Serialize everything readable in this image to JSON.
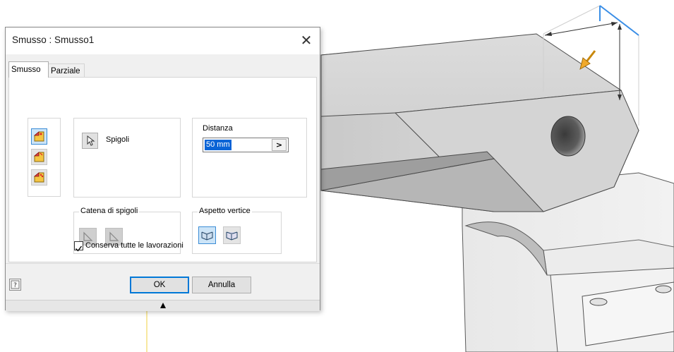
{
  "dialog": {
    "title": "Smusso : Smusso1",
    "close_glyph": "✕"
  },
  "tabs": [
    {
      "label": "Smusso",
      "active": true
    },
    {
      "label": "Parziale",
      "active": false
    }
  ],
  "modes": [
    "chamfer-distance-icon",
    "chamfer-distance-angle-icon",
    "chamfer-two-distances-icon"
  ],
  "edges": {
    "label": "Spigoli",
    "icon": "cursor-select-icon"
  },
  "distance": {
    "label": "Distanza",
    "value": "50 mm",
    "arrow": ">"
  },
  "edge_chain": {
    "label": "Catena di spigoli",
    "buttons": [
      "single-edge-icon",
      "all-tangent-edges-icon"
    ]
  },
  "vertex_setback": {
    "label": "Aspetto vertice",
    "buttons": [
      "setback-off-icon",
      "setback-on-icon"
    ]
  },
  "preserve": {
    "label": "Conserva tutte le lavorazioni",
    "checked": true
  },
  "buttons": {
    "ok": "OK",
    "cancel": "Annulla",
    "help_glyph": "?"
  },
  "colors": {
    "accent": "#0078d7",
    "selection": "#0a64d6",
    "manipulator": "#f0a92a",
    "highlight_edge": "#3a8ee6"
  }
}
